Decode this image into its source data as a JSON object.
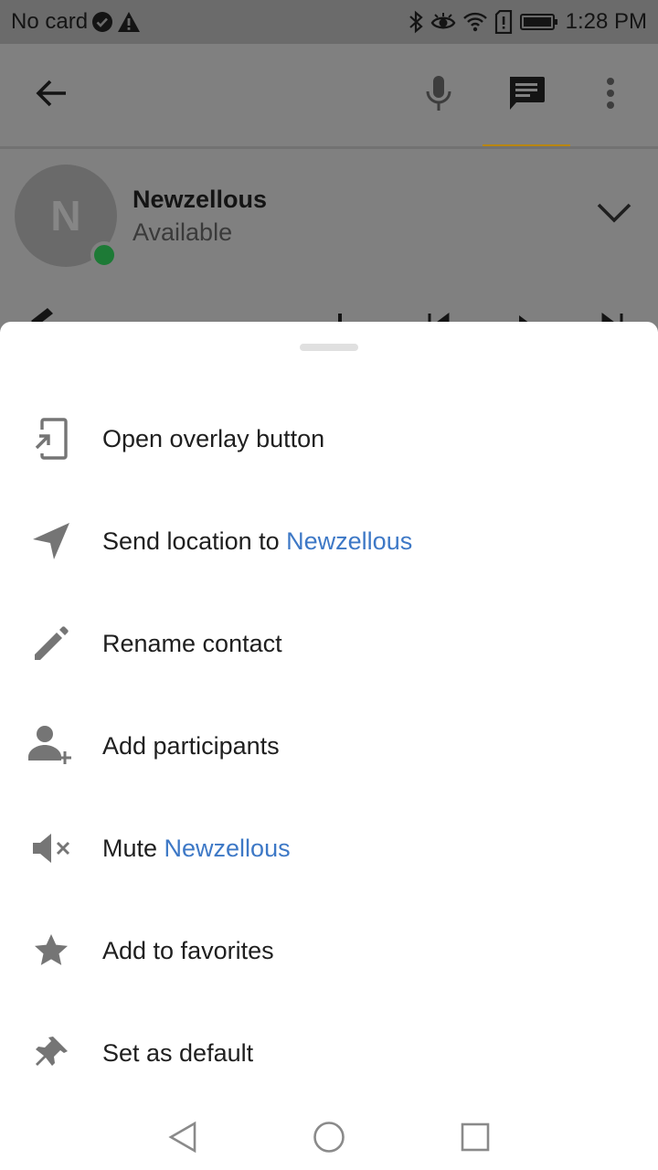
{
  "status_bar": {
    "carrier": "No card",
    "time": "1:28 PM",
    "icons": [
      "check-circle-icon",
      "warning-icon",
      "bluetooth-icon",
      "eye-icon",
      "wifi-icon",
      "alert-icon",
      "battery-icon"
    ]
  },
  "app_bar": {
    "icons": [
      "back-arrow-icon",
      "mic-icon",
      "chat-icon",
      "more-vert-icon"
    ],
    "active_tab_color": "#b8860b"
  },
  "contact": {
    "initial": "N",
    "name": "Newzellous",
    "status": "Available",
    "presence_color": "#1d7a36"
  },
  "menu": {
    "items": [
      {
        "icon": "overlay-icon",
        "label": "Open overlay button",
        "highlight": ""
      },
      {
        "icon": "send-location-icon",
        "label": "Send location to ",
        "highlight": "Newzellous"
      },
      {
        "icon": "pencil-icon",
        "label": "Rename contact",
        "highlight": ""
      },
      {
        "icon": "add-person-icon",
        "label": "Add participants",
        "highlight": ""
      },
      {
        "icon": "mute-icon",
        "label": "Mute ",
        "highlight": "Newzellous"
      },
      {
        "icon": "star-icon",
        "label": "Add to favorites",
        "highlight": ""
      },
      {
        "icon": "pin-icon",
        "label": "Set as default",
        "highlight": ""
      }
    ],
    "highlight_color": "#3d78c6"
  },
  "nav_bar": {
    "icons": [
      "nav-back-icon",
      "nav-home-icon",
      "nav-recents-icon"
    ]
  }
}
